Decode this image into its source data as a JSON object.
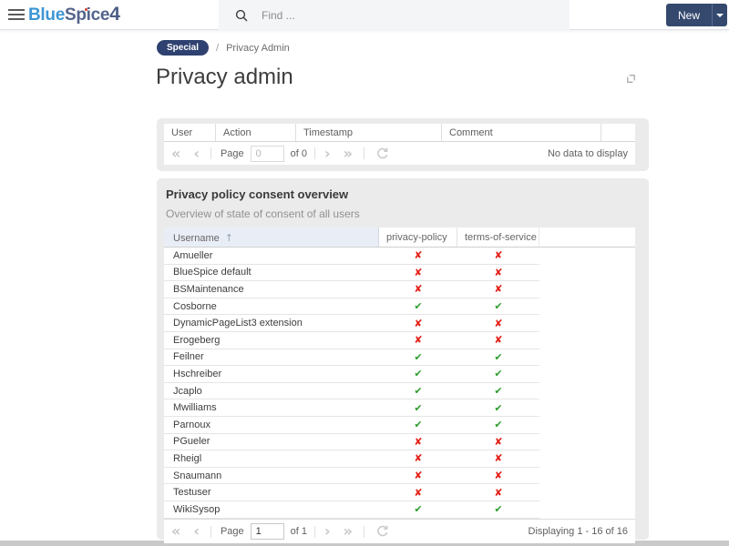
{
  "header": {
    "logo": {
      "part1": "Blue",
      "part2": "Spice",
      "part3": "4"
    },
    "search": {
      "placeholder": "Find ..."
    },
    "new_button_label": "New"
  },
  "breadcrumb": {
    "badge": "Special",
    "separator": "/",
    "current": "Privacy Admin"
  },
  "page": {
    "title": "Privacy admin"
  },
  "icons": {
    "first_page": "«",
    "prev_page": "‹",
    "next_page": "›",
    "last_page": "»",
    "check": "✔",
    "cross": "✘",
    "sort_asc": "↑"
  },
  "log_grid": {
    "columns": {
      "user": "User",
      "action": "Action",
      "timestamp": "Timestamp",
      "comment": "Comment"
    },
    "pagination": {
      "page_label": "Page",
      "page_value": "0",
      "of_label": "of 0",
      "status": "No data to display"
    }
  },
  "consent_panel": {
    "title": "Privacy policy consent overview",
    "subtitle": "Overview of state of consent of all users",
    "columns": {
      "username": "Username",
      "privacy_policy": "privacy-policy",
      "terms_of_service": "terms-of-service"
    },
    "rows": [
      {
        "username": "Amueller",
        "privacy_policy": false,
        "terms_of_service": false
      },
      {
        "username": "BlueSpice default",
        "privacy_policy": false,
        "terms_of_service": false
      },
      {
        "username": "BSMaintenance",
        "privacy_policy": false,
        "terms_of_service": false
      },
      {
        "username": "Cosborne",
        "privacy_policy": true,
        "terms_of_service": true
      },
      {
        "username": "DynamicPageList3 extension",
        "privacy_policy": false,
        "terms_of_service": false
      },
      {
        "username": "Erogeberg",
        "privacy_policy": false,
        "terms_of_service": false
      },
      {
        "username": "Feilner",
        "privacy_policy": true,
        "terms_of_service": true
      },
      {
        "username": "Hschreiber",
        "privacy_policy": true,
        "terms_of_service": true
      },
      {
        "username": "Jcaplo",
        "privacy_policy": true,
        "terms_of_service": true
      },
      {
        "username": "Mwilliams",
        "privacy_policy": true,
        "terms_of_service": true
      },
      {
        "username": "Parnoux",
        "privacy_policy": true,
        "terms_of_service": true
      },
      {
        "username": "PGueler",
        "privacy_policy": false,
        "terms_of_service": false
      },
      {
        "username": "Rheigl",
        "privacy_policy": false,
        "terms_of_service": false
      },
      {
        "username": "Snaumann",
        "privacy_policy": false,
        "terms_of_service": false
      },
      {
        "username": "Testuser",
        "privacy_policy": false,
        "terms_of_service": false
      },
      {
        "username": "WikiSysop",
        "privacy_policy": true,
        "terms_of_service": true
      }
    ],
    "pagination": {
      "page_label": "Page",
      "page_value": "1",
      "of_label": "of 1",
      "status": "Displaying 1 - 16 of 16"
    }
  },
  "colors": {
    "logo_blue": "#3e96d4",
    "logo_slate": "#53648c",
    "accent_navy": "#35496f",
    "badge_bg": "#2e4170",
    "check_green": "#2f9e2f",
    "cross_red": "#e32119",
    "sorted_column_bg": "#e9eef6"
  }
}
